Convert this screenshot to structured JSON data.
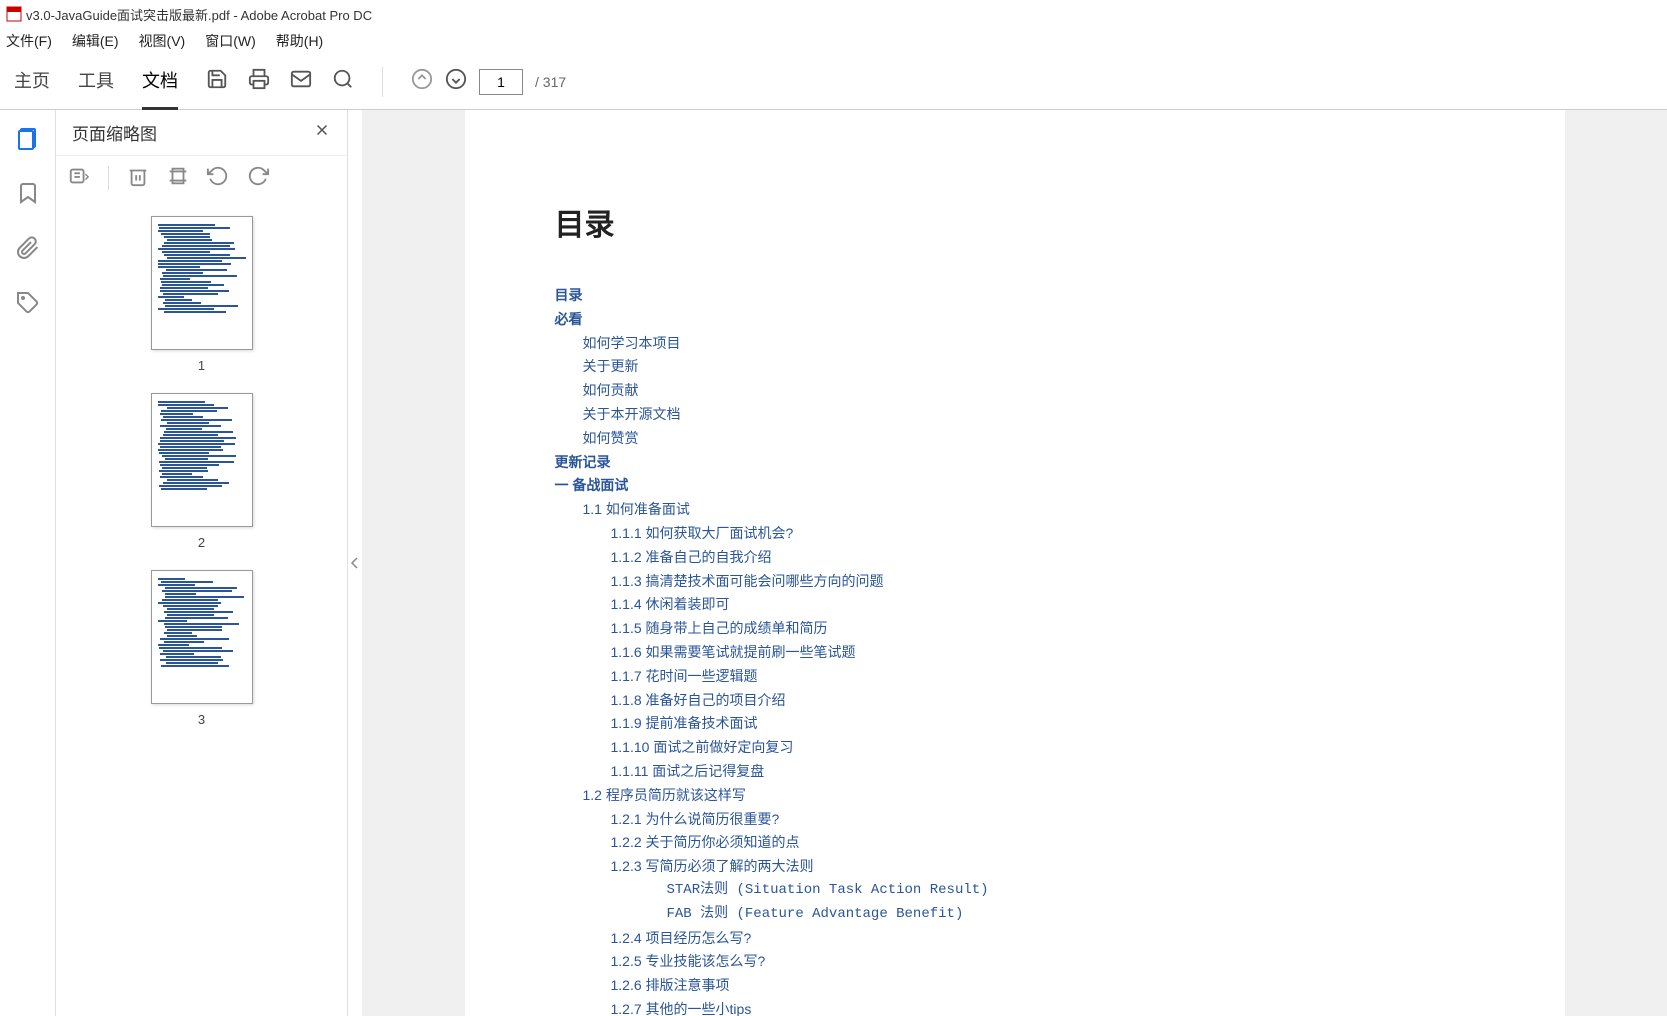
{
  "window": {
    "title": "v3.0-JavaGuide面试突击版最新.pdf - Adobe Acrobat Pro DC"
  },
  "menu": {
    "file": "文件(F)",
    "edit": "编辑(E)",
    "view": "视图(V)",
    "window": "窗口(W)",
    "help": "帮助(H)"
  },
  "toolbar": {
    "tabs": {
      "home": "主页",
      "tools": "工具",
      "document": "文档"
    },
    "page_current": "1",
    "page_total": "/ 317"
  },
  "sidebar": {
    "panel_title": "页面缩略图",
    "thumbs": [
      "1",
      "2",
      "3"
    ]
  },
  "document": {
    "heading": "目录",
    "toc": [
      {
        "level": 0,
        "text": "目录"
      },
      {
        "level": 0,
        "text": "必看"
      },
      {
        "level": 1,
        "text": "如何学习本项目"
      },
      {
        "level": 1,
        "text": "关于更新"
      },
      {
        "level": 1,
        "text": "如何贡献"
      },
      {
        "level": 1,
        "text": "关于本开源文档"
      },
      {
        "level": 1,
        "text": "如何赞赏"
      },
      {
        "level": 0,
        "text": "更新记录"
      },
      {
        "level": 0,
        "text": "一   备战面试"
      },
      {
        "level": 1,
        "text": "1.1  如何准备面试"
      },
      {
        "level": 2,
        "text": "1.1.1  如何获取大厂面试机会?"
      },
      {
        "level": 2,
        "text": "1.1.2  准备自己的自我介绍"
      },
      {
        "level": 2,
        "text": "1.1.3  搞清楚技术面可能会问哪些方向的问题"
      },
      {
        "level": 2,
        "text": "1.1.4  休闲着装即可"
      },
      {
        "level": 2,
        "text": "1.1.5  随身带上自己的成绩单和简历"
      },
      {
        "level": 2,
        "text": "1.1.6  如果需要笔试就提前刷一些笔试题"
      },
      {
        "level": 2,
        "text": "1.1.7  花时间一些逻辑题"
      },
      {
        "level": 2,
        "text": "1.1.8  准备好自己的项目介绍"
      },
      {
        "level": 2,
        "text": "1.1.9  提前准备技术面试"
      },
      {
        "level": 2,
        "text": "1.1.10  面试之前做好定向复习"
      },
      {
        "level": 2,
        "text": "1.1.11  面试之后记得复盘"
      },
      {
        "level": 1,
        "text": "1.2  程序员简历就该这样写"
      },
      {
        "level": 2,
        "text": "1.2.1  为什么说简历很重要?"
      },
      {
        "level": 2,
        "text": "1.2.2  关于简历你必须知道的点"
      },
      {
        "level": 2,
        "text": "1.2.3  写简历必须了解的两大法则"
      },
      {
        "level": 3,
        "text": "STAR法则 (Situation Task Action Result)"
      },
      {
        "level": 3,
        "text": "FAB 法则 (Feature Advantage Benefit)"
      },
      {
        "level": 2,
        "text": "1.2.4  项目经历怎么写?"
      },
      {
        "level": 2,
        "text": "1.2.5  专业技能该怎么写?"
      },
      {
        "level": 2,
        "text": "1.2.6  排版注意事项"
      },
      {
        "level": 2,
        "text": "1.2.7  其他的一些小tips"
      }
    ]
  }
}
